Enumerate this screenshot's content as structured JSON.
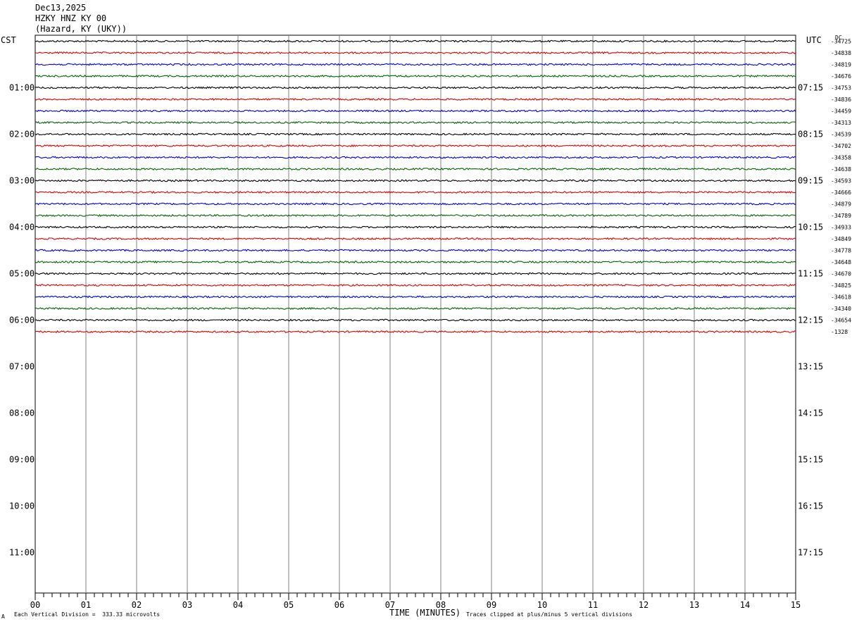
{
  "header": {
    "date": "Dec13,2025",
    "station": "HZKY HNZ KY 00",
    "location": "(Hazard, KY (UKY))"
  },
  "left_tz": "CST",
  "right_tz": "UTC",
  "dc_label": "DC",
  "footer": {
    "corner_mark": "A",
    "scale_note": "Each Vertical Division =  333.33 microvolts",
    "xlabel": "TIME (MINUTES)",
    "clip_note": "Traces clipped at plus/minus 5 vertical divisions"
  },
  "chart_data": {
    "type": "line",
    "title": "HZKY HNZ KY 00",
    "subtitle": "(Hazard, KY (UKY))",
    "xlabel": "TIME (MINUTES)",
    "xlim": [
      0,
      15
    ],
    "x_ticks": [
      "00",
      "01",
      "02",
      "03",
      "04",
      "05",
      "06",
      "07",
      "08",
      "09",
      "10",
      "11",
      "12",
      "13",
      "14",
      "15"
    ],
    "rows_per_hour": 4,
    "row_minutes": 15,
    "left_hour_labels": [
      "01:00",
      "02:00",
      "03:00",
      "04:00",
      "05:00",
      "06:00",
      "07:00",
      "08:00",
      "09:00",
      "10:00",
      "11:00"
    ],
    "right_hour_labels": [
      "07:15",
      "08:15",
      "09:15",
      "10:15",
      "11:15",
      "12:15",
      "13:15",
      "14:15",
      "15:15",
      "16:15",
      "17:15"
    ],
    "trace_colors": [
      "#000000",
      "#dd0000",
      "#0000dd",
      "#006600"
    ],
    "trace_count": 26,
    "dc_offsets": [
      "-34725",
      "-34838",
      "-34819",
      "-34676",
      "-34753",
      "-34836",
      "-34459",
      "-34313",
      "-34539",
      "-34702",
      "-34358",
      "-34638",
      "-34593",
      "-34666",
      "-34879",
      "-34789",
      "-34933",
      "-34849",
      "-34778",
      "-34648",
      "-34670",
      "-34825",
      "-34618",
      "-34340",
      "-34654",
      "-1328"
    ]
  }
}
